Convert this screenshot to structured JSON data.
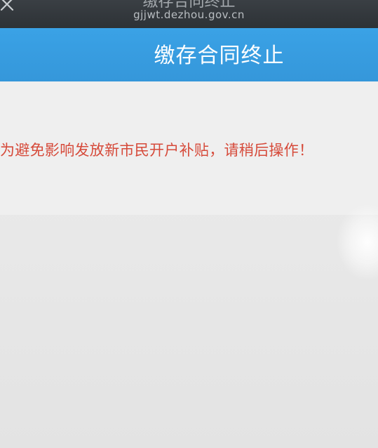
{
  "browser": {
    "title": "缴存合同终止",
    "url": "gjjwt.dezhou.gov.cn",
    "close_icon": "close-icon"
  },
  "header": {
    "title": "缴存合同终止",
    "background": "#3597da"
  },
  "notice": {
    "text": "为避免影响发放新市民开户补贴，请稍后操作！",
    "color": "#d64a3a"
  }
}
